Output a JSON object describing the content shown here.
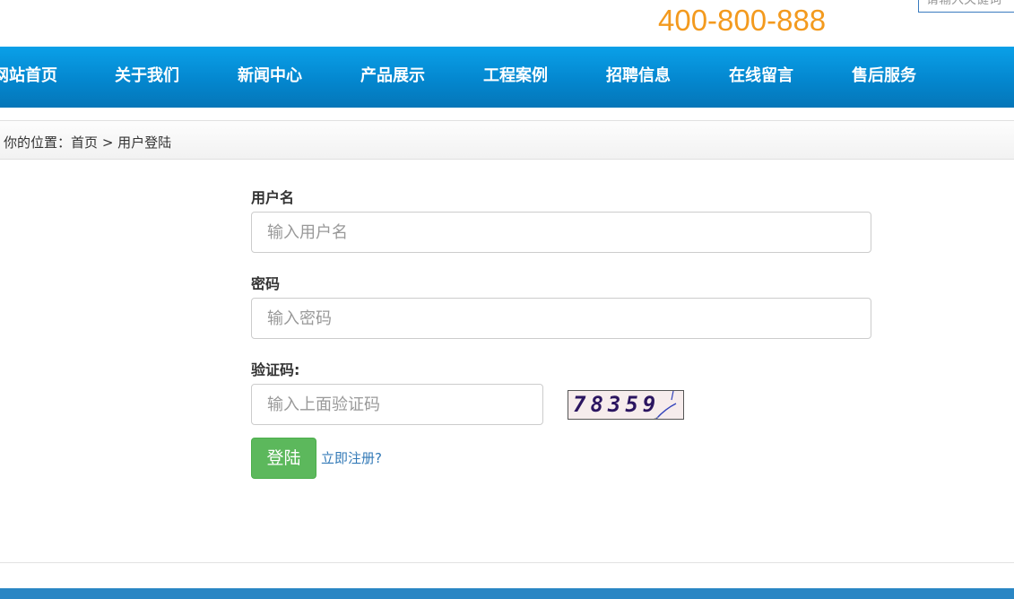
{
  "header": {
    "phone": "400-800-888",
    "search_placeholder": "请输入关键词"
  },
  "nav": {
    "items": [
      {
        "label": "网站首页"
      },
      {
        "label": "关于我们"
      },
      {
        "label": "新闻中心"
      },
      {
        "label": "产品展示"
      },
      {
        "label": "工程案例"
      },
      {
        "label": "招聘信息"
      },
      {
        "label": "在线留言"
      },
      {
        "label": "售后服务"
      }
    ]
  },
  "breadcrumb": {
    "prefix": "你的位置：",
    "home": "首页",
    "separator": ">",
    "current": "用户登陆"
  },
  "form": {
    "username_label": "用户名",
    "username_placeholder": "输入用户名",
    "password_label": "密码",
    "password_placeholder": "输入密码",
    "captcha_label": "验证码:",
    "captcha_placeholder": "输入上面验证码",
    "captcha_text": "78359",
    "login_label": "登陆",
    "register_label": "立即注册?"
  },
  "colors": {
    "nav_blue": "#0487cf",
    "phone_orange": "#f39a1e",
    "login_green": "#5cb85c",
    "link_blue": "#337ab7",
    "footer_blue": "#2a86c4"
  }
}
